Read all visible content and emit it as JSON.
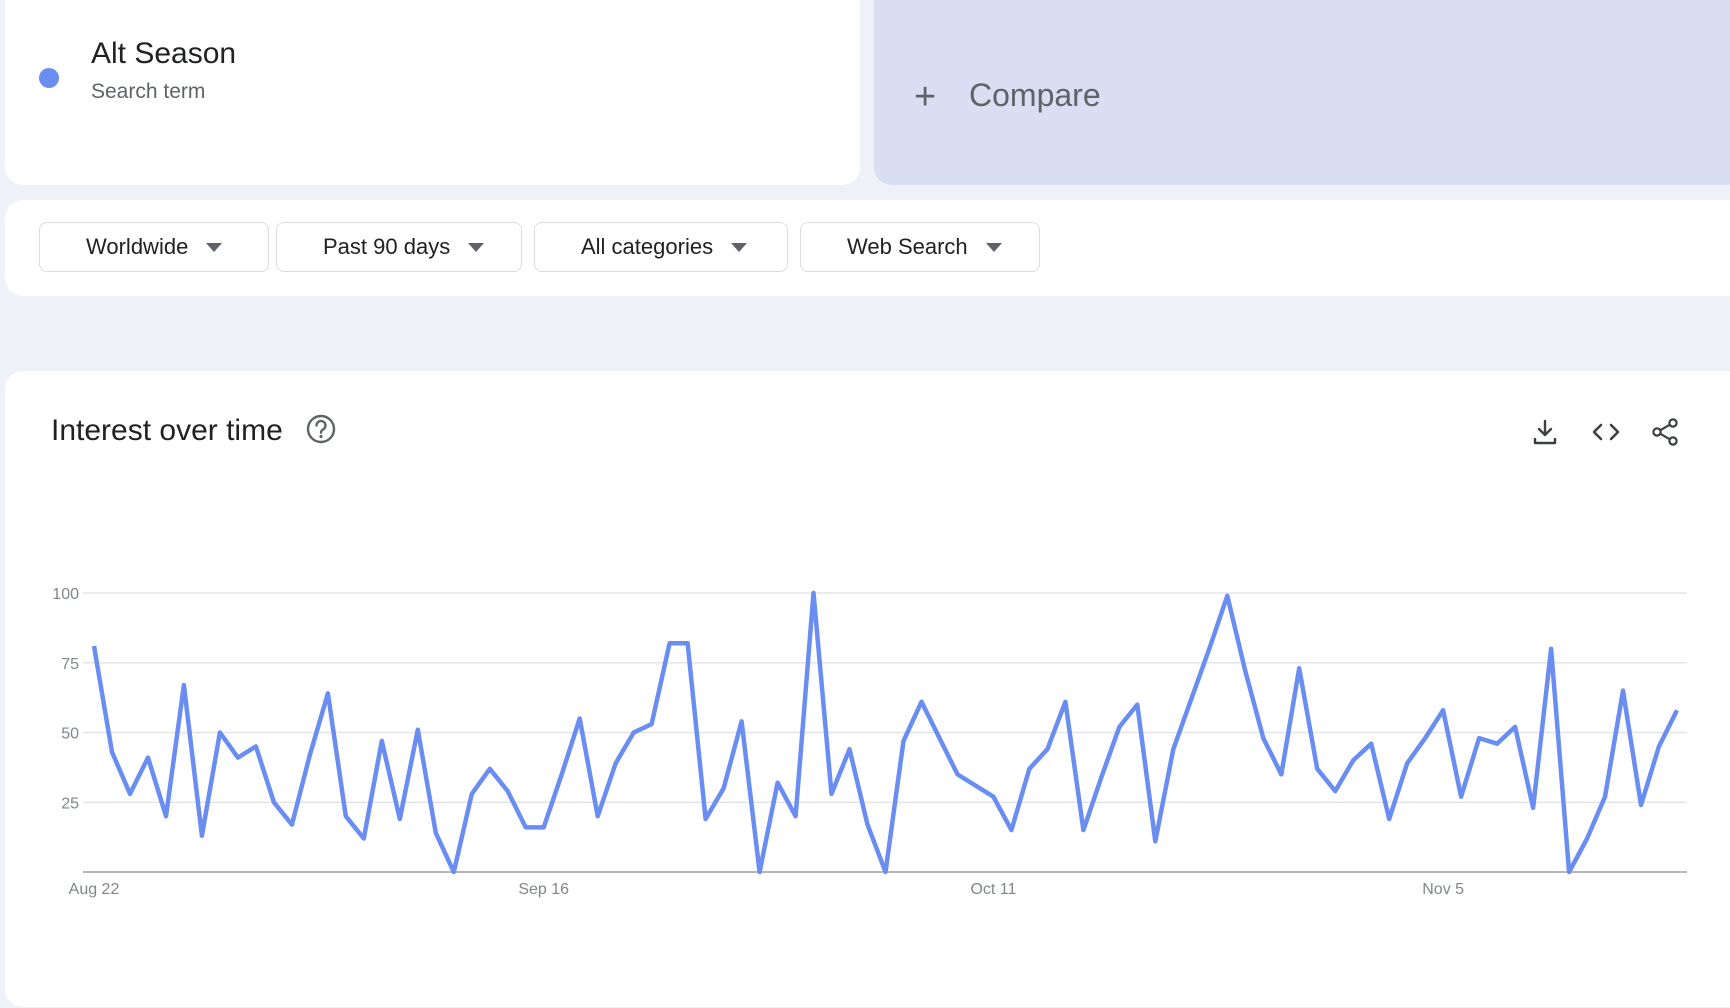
{
  "search_term": {
    "name": "Alt Season",
    "type_label": "Search term",
    "color": "#6a8df2"
  },
  "compare": {
    "icon": "plus-icon",
    "label": "Compare"
  },
  "filters": [
    {
      "label": "Worldwide"
    },
    {
      "label": "Past 90 days"
    },
    {
      "label": "All categories"
    },
    {
      "label": "Web Search"
    }
  ],
  "panel": {
    "title": "Interest over time",
    "icons": [
      "help-icon",
      "download-icon",
      "embed-icon",
      "share-icon"
    ]
  },
  "chart_data": {
    "type": "line",
    "title": "Interest over time",
    "x_tick_labels": [
      "Aug 22",
      "Sep 16",
      "Oct 11",
      "Nov 5"
    ],
    "x_tick_indices": [
      0,
      25,
      50,
      75
    ],
    "y_ticks": [
      25,
      50,
      75,
      100
    ],
    "ylim": [
      0,
      100
    ],
    "grid": true,
    "series": [
      {
        "color": "#6a8df2",
        "values": [
          81,
          43,
          28,
          41,
          20,
          67,
          13,
          50,
          41,
          45,
          25,
          17,
          42,
          64,
          20,
          12,
          47,
          19,
          51,
          14,
          0,
          28,
          37,
          29,
          16,
          16,
          35,
          55,
          20,
          39,
          50,
          53,
          82,
          82,
          19,
          30,
          54,
          0,
          32,
          20,
          100,
          28,
          44,
          17,
          0,
          47,
          61,
          48,
          35,
          31,
          27,
          15,
          37,
          44,
          61,
          15,
          34,
          52,
          60,
          11,
          44,
          62,
          80,
          99,
          72,
          48,
          35,
          73,
          37,
          29,
          40,
          46,
          19,
          39,
          48,
          58,
          27,
          48,
          46,
          52,
          23,
          80,
          0,
          12,
          27,
          65,
          24,
          45,
          58
        ]
      }
    ]
  }
}
